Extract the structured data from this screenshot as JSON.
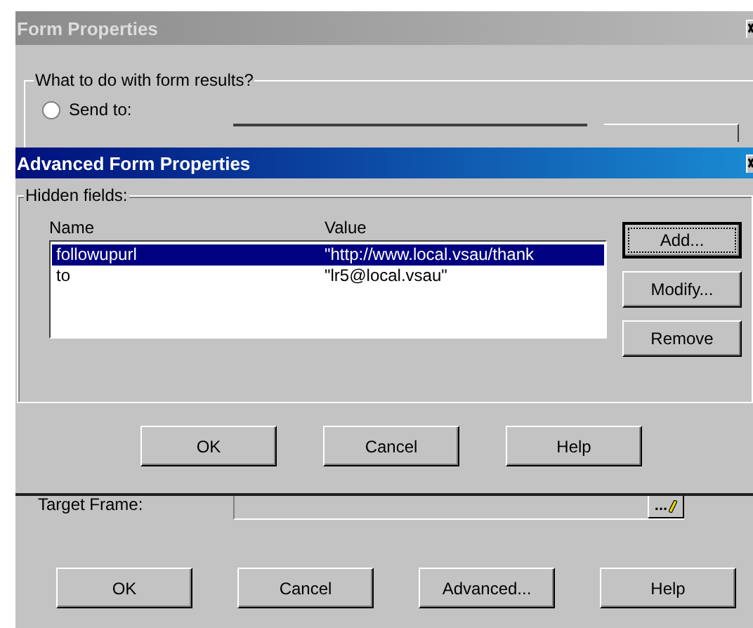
{
  "back_window": {
    "title": "Form Properties",
    "group_label": "What to do with form results?",
    "radio": {
      "label": "Send to:",
      "selected": false
    },
    "target_frame_label": "Target Frame:",
    "browse_button": "...",
    "buttons": [
      "OK",
      "Cancel",
      "Advanced...",
      "Help"
    ]
  },
  "dialog": {
    "title": "Advanced Form Properties",
    "group_label": "Hidden fields:",
    "columns": [
      "Name",
      "Value"
    ],
    "rows": [
      {
        "name": "followupurl",
        "value": "\"http://www.local.vsau/thank",
        "selected": true
      },
      {
        "name": "to",
        "value": "\"lr5@local.vsau\"",
        "selected": false
      }
    ],
    "side_buttons": [
      {
        "label": "Add...",
        "focused": true
      },
      {
        "label": "Modify...",
        "focused": false
      },
      {
        "label": "Remove",
        "focused": false
      }
    ],
    "buttons": [
      "OK",
      "Cancel",
      "Help"
    ]
  }
}
